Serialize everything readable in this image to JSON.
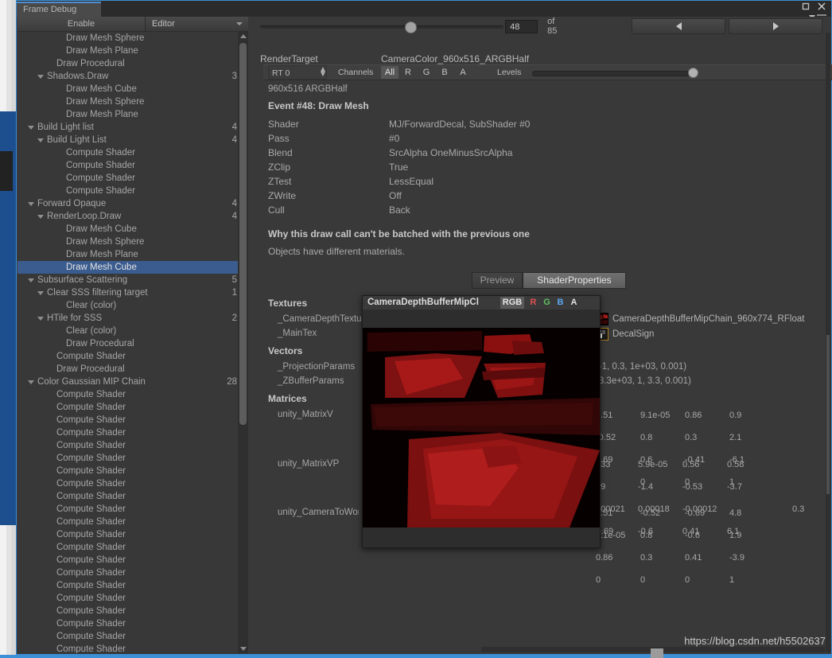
{
  "window": {
    "tab_title": "Frame Debug",
    "buttons": {
      "maximize": "maximize-icon",
      "close": "close-icon",
      "menu": "panel-menu-icon"
    }
  },
  "toolbar": {
    "enable_label": "Enable",
    "target_dropdown": "Editor",
    "event_index": "48",
    "event_total": "of 85",
    "prev_label": "◀",
    "next_label": "▶"
  },
  "tree": {
    "items": [
      {
        "label": "Draw Mesh Sphere",
        "indent": 4,
        "arrow": false,
        "count": ""
      },
      {
        "label": "Draw Mesh Plane",
        "indent": 4,
        "arrow": false,
        "count": ""
      },
      {
        "label": "Draw Procedural",
        "indent": 3,
        "arrow": false,
        "count": ""
      },
      {
        "label": "Shadows.Draw",
        "indent": 2,
        "arrow": true,
        "count": "3"
      },
      {
        "label": "Draw Mesh Cube",
        "indent": 4,
        "arrow": false,
        "count": ""
      },
      {
        "label": "Draw Mesh Sphere",
        "indent": 4,
        "arrow": false,
        "count": ""
      },
      {
        "label": "Draw Mesh Plane",
        "indent": 4,
        "arrow": false,
        "count": ""
      },
      {
        "label": "Build Light list",
        "indent": 1,
        "arrow": true,
        "count": "4"
      },
      {
        "label": "Build Light List",
        "indent": 2,
        "arrow": true,
        "count": "4"
      },
      {
        "label": "Compute Shader",
        "indent": 4,
        "arrow": false,
        "count": ""
      },
      {
        "label": "Compute Shader",
        "indent": 4,
        "arrow": false,
        "count": ""
      },
      {
        "label": "Compute Shader",
        "indent": 4,
        "arrow": false,
        "count": ""
      },
      {
        "label": "Compute Shader",
        "indent": 4,
        "arrow": false,
        "count": ""
      },
      {
        "label": "Forward Opaque",
        "indent": 1,
        "arrow": true,
        "count": "4"
      },
      {
        "label": "RenderLoop.Draw",
        "indent": 2,
        "arrow": true,
        "count": "4"
      },
      {
        "label": "Draw Mesh Cube",
        "indent": 4,
        "arrow": false,
        "count": ""
      },
      {
        "label": "Draw Mesh Sphere",
        "indent": 4,
        "arrow": false,
        "count": ""
      },
      {
        "label": "Draw Mesh Plane",
        "indent": 4,
        "arrow": false,
        "count": ""
      },
      {
        "label": "Draw Mesh Cube",
        "indent": 4,
        "arrow": false,
        "count": "",
        "selected": true
      },
      {
        "label": "Subsurface Scattering",
        "indent": 1,
        "arrow": true,
        "count": "5"
      },
      {
        "label": "Clear SSS filtering target",
        "indent": 2,
        "arrow": true,
        "count": "1"
      },
      {
        "label": "Clear (color)",
        "indent": 4,
        "arrow": false,
        "count": ""
      },
      {
        "label": "HTile for SSS",
        "indent": 2,
        "arrow": true,
        "count": "2"
      },
      {
        "label": "Clear (color)",
        "indent": 4,
        "arrow": false,
        "count": ""
      },
      {
        "label": "Draw Procedural",
        "indent": 4,
        "arrow": false,
        "count": ""
      },
      {
        "label": "Compute Shader",
        "indent": 3,
        "arrow": false,
        "count": ""
      },
      {
        "label": "Draw Procedural",
        "indent": 3,
        "arrow": false,
        "count": ""
      },
      {
        "label": "Color Gaussian MIP Chain",
        "indent": 1,
        "arrow": true,
        "count": "28"
      },
      {
        "label": "Compute Shader",
        "indent": 3,
        "arrow": false,
        "count": ""
      },
      {
        "label": "Compute Shader",
        "indent": 3,
        "arrow": false,
        "count": ""
      },
      {
        "label": "Compute Shader",
        "indent": 3,
        "arrow": false,
        "count": ""
      },
      {
        "label": "Compute Shader",
        "indent": 3,
        "arrow": false,
        "count": ""
      },
      {
        "label": "Compute Shader",
        "indent": 3,
        "arrow": false,
        "count": ""
      },
      {
        "label": "Compute Shader",
        "indent": 3,
        "arrow": false,
        "count": ""
      },
      {
        "label": "Compute Shader",
        "indent": 3,
        "arrow": false,
        "count": ""
      },
      {
        "label": "Compute Shader",
        "indent": 3,
        "arrow": false,
        "count": ""
      },
      {
        "label": "Compute Shader",
        "indent": 3,
        "arrow": false,
        "count": ""
      },
      {
        "label": "Compute Shader",
        "indent": 3,
        "arrow": false,
        "count": ""
      },
      {
        "label": "Compute Shader",
        "indent": 3,
        "arrow": false,
        "count": ""
      },
      {
        "label": "Compute Shader",
        "indent": 3,
        "arrow": false,
        "count": ""
      },
      {
        "label": "Compute Shader",
        "indent": 3,
        "arrow": false,
        "count": ""
      },
      {
        "label": "Compute Shader",
        "indent": 3,
        "arrow": false,
        "count": ""
      },
      {
        "label": "Compute Shader",
        "indent": 3,
        "arrow": false,
        "count": ""
      },
      {
        "label": "Compute Shader",
        "indent": 3,
        "arrow": false,
        "count": ""
      },
      {
        "label": "Compute Shader",
        "indent": 3,
        "arrow": false,
        "count": ""
      },
      {
        "label": "Compute Shader",
        "indent": 3,
        "arrow": false,
        "count": ""
      },
      {
        "label": "Compute Shader",
        "indent": 3,
        "arrow": false,
        "count": ""
      },
      {
        "label": "Compute Shader",
        "indent": 3,
        "arrow": false,
        "count": ""
      },
      {
        "label": "Compute Shader",
        "indent": 3,
        "arrow": false,
        "count": ""
      }
    ]
  },
  "rendertarget": {
    "label": "RenderTarget",
    "value": "CameraColor_960x516_ARGBHalf",
    "rt_select": "RT 0",
    "channels_label": "Channels",
    "channels": [
      "All",
      "R",
      "G",
      "B",
      "A"
    ],
    "channel_selected": "All",
    "levels_label": "Levels",
    "format_line": "960x516 ARGBHalf"
  },
  "event": {
    "title": "Event #48: Draw Mesh",
    "rows": [
      {
        "key": "Shader",
        "value": "MJ/ForwardDecal, SubShader #0"
      },
      {
        "key": "Pass",
        "value": "#0"
      },
      {
        "key": "Blend",
        "value": "SrcAlpha OneMinusSrcAlpha"
      },
      {
        "key": "ZClip",
        "value": "True"
      },
      {
        "key": "ZTest",
        "value": "LessEqual"
      },
      {
        "key": "ZWrite",
        "value": "Off"
      },
      {
        "key": "Cull",
        "value": "Back"
      }
    ]
  },
  "batching": {
    "title": "Why this draw call can't be batched with the previous one",
    "reason": "Objects have different materials."
  },
  "detail_tabs": {
    "preview": "Preview",
    "shader_properties": "ShaderProperties",
    "selected": "ShaderProperties"
  },
  "shader_props": {
    "textures_head": "Textures",
    "textures": [
      {
        "name": "_CameraDepthTexture",
        "value": "CameraDepthBufferMipChain_960x774_RFloat"
      },
      {
        "name": "_MainTex",
        "value": "DecalSign"
      }
    ],
    "vectors_head": "Vectors",
    "vectors": [
      {
        "name": "_ProjectionParams",
        "value": "(-1, 0.3, 1e+03, 0.001)"
      },
      {
        "name": "_ZBufferParams",
        "value": "(3.3e+03, 1, 3.3, 0.001)"
      }
    ],
    "matrices_head": "Matrices",
    "matrices": [
      {
        "name": "unity_MatrixV",
        "rows": [
          [
            "0.51",
            "9.1e-05",
            "0.86",
            "0.9",
            ""
          ],
          [
            "-0.52",
            "0.8",
            "0.3",
            "2.1",
            ""
          ],
          [
            "0.69",
            "0.6",
            "-0.41",
            "-6.1",
            ""
          ],
          [
            "0",
            "0",
            "0",
            "1",
            ""
          ]
        ]
      },
      {
        "name": "unity_MatrixVP",
        "rows": [
          [
            "0.33",
            "5.9e-05",
            "0.56",
            "0.58",
            ""
          ],
          [
            "0.9",
            "-1.4",
            "-0.53",
            "-3.7",
            ""
          ],
          [
            "0.00021",
            "0.00018",
            "-0.00012",
            "",
            "0.3"
          ],
          [
            "-0.69",
            "-0.6",
            "0.41",
            "6.1",
            ""
          ]
        ]
      },
      {
        "name": "unity_CameraToWorld",
        "rows": [
          [
            "0.51",
            "-0.52",
            "-0.69",
            "4.8",
            ""
          ],
          [
            "9.1e-05",
            "0.8",
            "-0.6",
            "1.9",
            ""
          ],
          [
            "0.86",
            "0.3",
            "0.41",
            "-3.9",
            ""
          ],
          [
            "0",
            "0",
            "0",
            "1",
            ""
          ]
        ]
      }
    ]
  },
  "popup": {
    "title": "CameraDepthBufferMipCl",
    "rgb_label": "RGB",
    "channels": [
      "R",
      "G",
      "B",
      "A"
    ],
    "channel_colors": {
      "R": "#e05050",
      "G": "#5ec05e",
      "B": "#5da8f0",
      "A": "#e0e0e0"
    }
  },
  "watermark": "https://blog.csdn.net/h5502637",
  "colors": {
    "selection": "#3b5c8f",
    "window_border": "#3d8fd6",
    "panel_bg": "#383838",
    "text": "#a6a6a6"
  }
}
